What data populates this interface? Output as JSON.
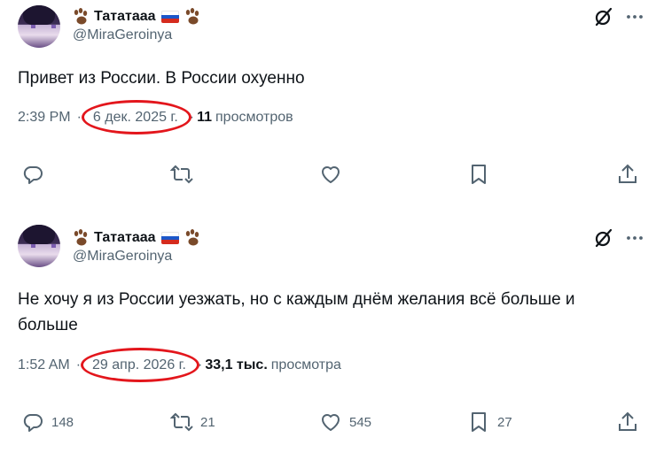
{
  "tweets": [
    {
      "author": {
        "display_name": "Тататааа",
        "handle": "@MiraGeroinya",
        "icons": [
          "paw-icon",
          "russia-flag-icon",
          "paw-icon"
        ]
      },
      "text": "Привет из России. В России охуенно",
      "time": "2:39 PM",
      "date": "6 дек. 2025 г.",
      "views_count": "11",
      "views_label": "просмотров",
      "actions": {
        "replies": "",
        "retweets": "",
        "likes": ""
      }
    },
    {
      "author": {
        "display_name": "Тататааа",
        "handle": "@MiraGeroinya",
        "icons": [
          "paw-icon",
          "russia-flag-icon",
          "paw-icon"
        ]
      },
      "text": "Не хочу я из России уезжать, но с каждым днём желания всё больше и больше",
      "time": "1:52 AM",
      "date": "29 апр. 2026 г.",
      "views_count": "33,1 тыс.",
      "views_label": "просмотра",
      "actions": {
        "replies": "148",
        "retweets": "21",
        "likes": "545",
        "bookmarks": "27"
      }
    }
  ],
  "colors": {
    "text": "#0f1419",
    "secondary": "#536471",
    "highlight": "#e3161c",
    "flag_blue": "#1c57c9",
    "flag_red": "#d52b1e"
  }
}
